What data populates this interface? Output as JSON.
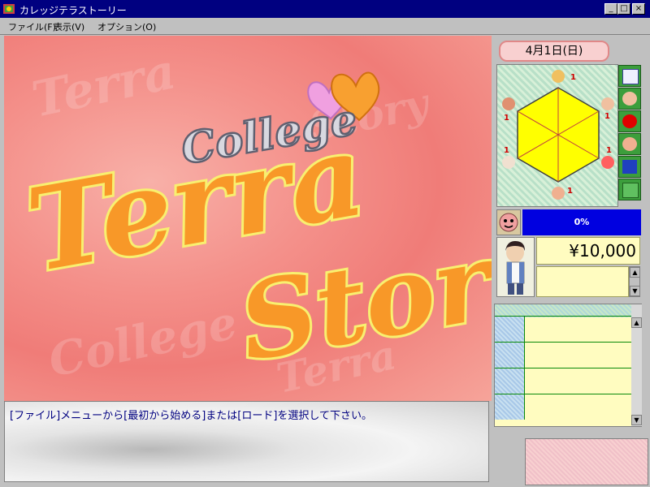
{
  "window": {
    "title": "カレッジテラストーリー",
    "controls": {
      "minimize": "_",
      "maximize": "□",
      "close": "×"
    }
  },
  "menu": {
    "items": [
      {
        "label": "ファイル(F)"
      },
      {
        "label": "表示(V)"
      },
      {
        "label": "オプション(O)"
      }
    ]
  },
  "logo": {
    "line1": "College",
    "line2": "Terra",
    "line3": "Story"
  },
  "message": {
    "text": "[ファイル]メニューから[最初から始める]または[ロード]を選択して下さい。"
  },
  "status": {
    "date": "4月1日(日)",
    "stats": [
      {
        "name": "stat-top",
        "value": "1"
      },
      {
        "name": "stat-top-right",
        "value": "1"
      },
      {
        "name": "stat-bottom-right",
        "value": "1"
      },
      {
        "name": "stat-bottom",
        "value": "1"
      },
      {
        "name": "stat-bottom-left",
        "value": "1"
      },
      {
        "name": "stat-top-left",
        "value": "1"
      }
    ],
    "mood_percent": "0%",
    "money": "¥10,000"
  },
  "colors": {
    "titlebar": "#000080",
    "accent_blue": "#0000e0",
    "message_text": "#000080",
    "radar_fill": "#ffff00",
    "stat_number": "#d00000"
  }
}
